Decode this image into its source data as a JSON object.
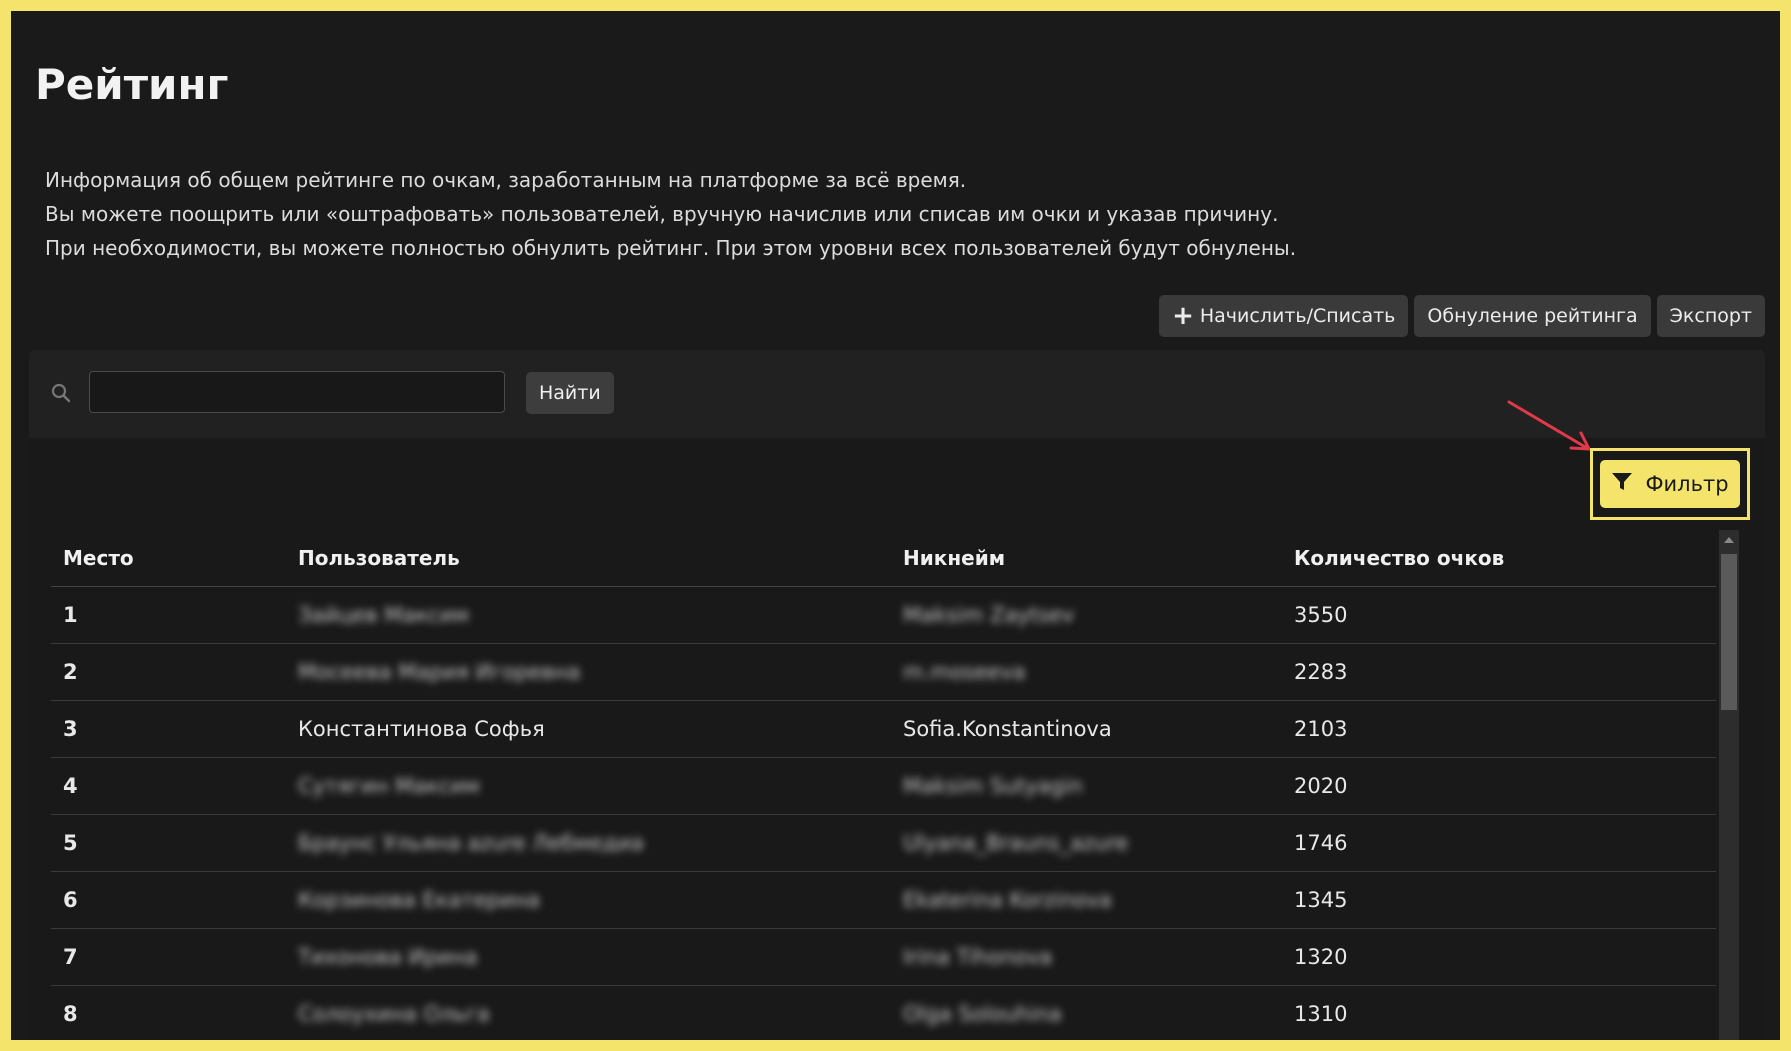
{
  "page": {
    "title": "Рейтинг",
    "description": [
      "Информация об общем рейтинге по очкам, заработанным на платформе за всё время.",
      "Вы можете поощрить или «оштрафовать» пользователей, вручную начислив или списав им очки и указав причину.",
      "При необходимости, вы можете полностью обнулить рейтинг. При этом уровни всех пользователей будут обнулены."
    ]
  },
  "toolbar": {
    "accrue_label": "Начислить/Списать",
    "reset_label": "Обнуление рейтинга",
    "export_label": "Экспорт"
  },
  "search": {
    "value": "",
    "placeholder": "",
    "button_label": "Найти"
  },
  "filter": {
    "label": "Фильтр"
  },
  "colors": {
    "accent": "#f4e46c",
    "arrow": "#e03a4a",
    "background": "#1a1a1a"
  },
  "icons": [
    "plus-icon",
    "search-icon",
    "filter-icon"
  ],
  "table": {
    "headers": {
      "place": "Место",
      "user": "Пользователь",
      "nickname": "Никнейм",
      "points": "Количество очков"
    },
    "rows": [
      {
        "place": "1",
        "user": "Зайцев Максим",
        "nickname": "Maksim Zaytsev",
        "points": "3550",
        "blurred": true
      },
      {
        "place": "2",
        "user": "Мосеева Мария Игоревна",
        "nickname": "m.moseeva",
        "points": "2283",
        "blurred": true
      },
      {
        "place": "3",
        "user": "Константинова Софья",
        "nickname": "Sofia.Konstantinova",
        "points": "2103",
        "blurred": false
      },
      {
        "place": "4",
        "user": "Сутягин Максим",
        "nickname": "Maksim Sutyagin",
        "points": "2020",
        "blurred": true
      },
      {
        "place": "5",
        "user": "Браунс Ульяна azure Лебмедиа",
        "nickname": "Ulyana_Brauns_azure",
        "points": "1746",
        "blurred": true
      },
      {
        "place": "6",
        "user": "Корзинова Екатерина",
        "nickname": "Ekaterina Korzinova",
        "points": "1345",
        "blurred": true
      },
      {
        "place": "7",
        "user": "Тихонова Ирина",
        "nickname": "Irina Tihonova",
        "points": "1320",
        "blurred": true
      },
      {
        "place": "8",
        "user": "Солоухина Ольга",
        "nickname": "Olga Solouhina",
        "points": "1310",
        "blurred": true
      }
    ]
  }
}
